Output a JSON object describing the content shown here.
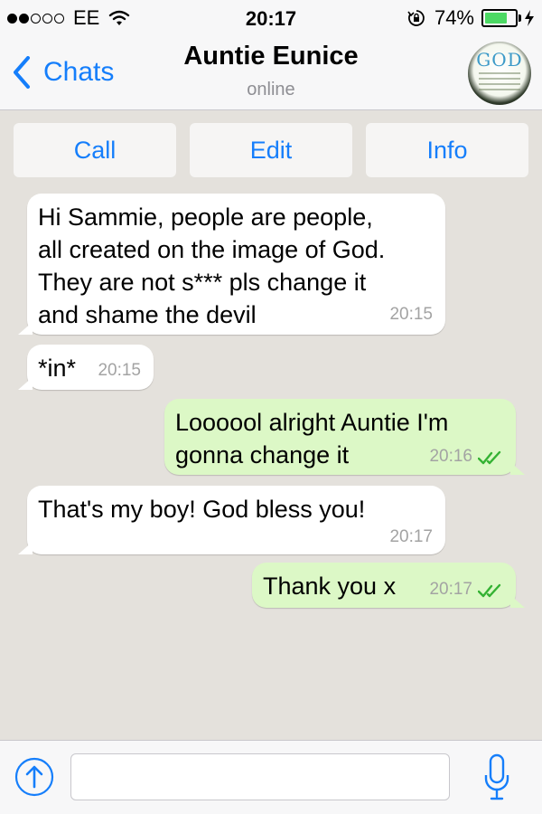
{
  "status_bar": {
    "carrier": "EE",
    "time": "20:17",
    "battery_percent": "74%",
    "battery_level": 0.74,
    "signal_bars_filled": 2,
    "signal_bars_total": 5
  },
  "nav": {
    "back_label": "Chats",
    "contact_name": "Auntie Eunice",
    "contact_status": "online",
    "avatar_text": "GOD"
  },
  "actions": {
    "call": "Call",
    "edit": "Edit",
    "info": "Info"
  },
  "messages": [
    {
      "direction": "incoming",
      "lines": [
        "Hi Sammie, people are people,",
        "all created on the image of God.",
        "They are not s*** pls change it",
        "and shame the devil"
      ],
      "time": "20:15"
    },
    {
      "direction": "incoming",
      "lines": [
        "*in*"
      ],
      "time": "20:15"
    },
    {
      "direction": "outgoing",
      "lines": [
        "Loooool alright Auntie I'm",
        "gonna change it"
      ],
      "time": "20:16",
      "read_ticks": true
    },
    {
      "direction": "incoming",
      "lines": [
        "That's my boy! God bless you!"
      ],
      "time": "20:17"
    },
    {
      "direction": "outgoing",
      "lines": [
        "Thank you x"
      ],
      "time": "20:17",
      "read_ticks": true
    }
  ],
  "input": {
    "placeholder": "",
    "value": ""
  },
  "colors": {
    "accent": "#157efb",
    "chat_background": "#e4e1dc",
    "outgoing_bubble": "#dcf8c6",
    "incoming_bubble": "#ffffff",
    "read_tick": "#34b233",
    "battery": "#4cd964"
  },
  "icons": {
    "wifi": "wifi-icon",
    "lock": "rotation-lock-icon",
    "bolt": "charging-bolt-icon",
    "back": "chevron-left-icon",
    "share": "share-up-arrow-icon",
    "mic": "microphone-icon",
    "ticks": "double-check-icon"
  }
}
